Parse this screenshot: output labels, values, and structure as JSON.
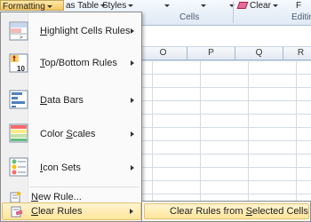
{
  "ribbon": {
    "formatting_label": "Formatting",
    "as_table_label": "as Table",
    "styles_label": "Styles",
    "clear_label": "Clear",
    "clear_partial_right": "F",
    "group_cells": "Cells",
    "group_editing": "Editin"
  },
  "columns": [
    "O",
    "P",
    "Q",
    "R"
  ],
  "menu": {
    "items": [
      {
        "pre": "",
        "u": "H",
        "post": "ighlight Cells Rules",
        "icon": "highlight-cells-rules-icon",
        "submenu": true
      },
      {
        "pre": "",
        "u": "T",
        "post": "op/Bottom Rules",
        "icon": "top-bottom-rules-icon",
        "submenu": true
      },
      {
        "pre": "",
        "u": "D",
        "post": "ata Bars",
        "icon": "data-bars-icon",
        "submenu": true
      },
      {
        "pre": "Color ",
        "u": "S",
        "post": "cales",
        "icon": "color-scales-icon",
        "submenu": true
      },
      {
        "pre": "",
        "u": "I",
        "post": "con Sets",
        "icon": "icon-sets-icon",
        "submenu": true
      },
      {
        "pre": "",
        "u": "N",
        "post": "ew Rule...",
        "icon": "new-rule-icon",
        "submenu": false
      },
      {
        "pre": "",
        "u": "C",
        "post": "lear Rules",
        "icon": "clear-rules-icon",
        "submenu": true
      }
    ]
  },
  "submenu": {
    "pre": "Clear Rules from ",
    "u": "S",
    "post": "elected Cells"
  },
  "colors": {
    "highlight": "#fee59a",
    "menu_bg": "#fafafa",
    "ribbon_bg": "#dfe9f5"
  }
}
